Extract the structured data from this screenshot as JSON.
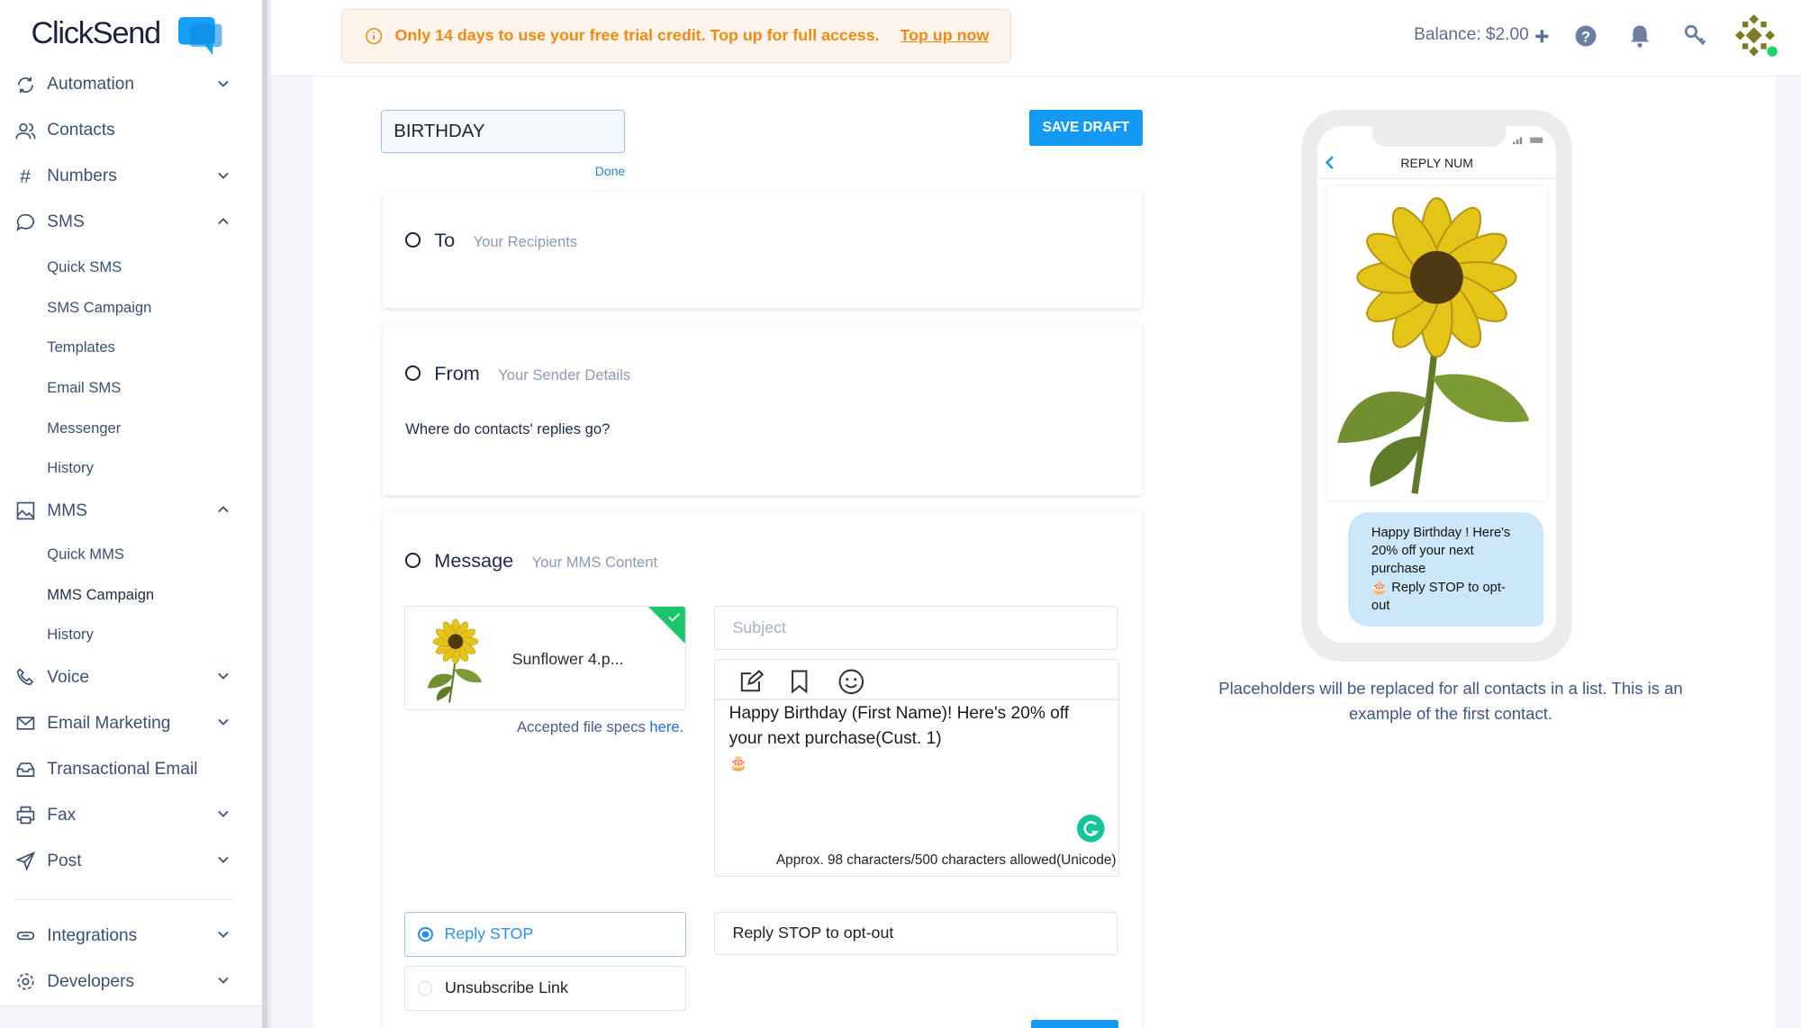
{
  "brand": {
    "logo_part1": "Click",
    "logo_part2": "Send",
    "accent": "#149af5"
  },
  "banner": {
    "text": "Only 14 days to use your free trial credit. Top up for full access.",
    "link": "Top up now"
  },
  "header": {
    "balance": "Balance: $2.00",
    "icons": [
      "plus-icon",
      "help-icon",
      "bell-icon",
      "key-icon",
      "avatar"
    ]
  },
  "sidebar": {
    "items": [
      {
        "label": "Automation"
      },
      {
        "label": "Contacts"
      },
      {
        "label": "Numbers"
      },
      {
        "label": "SMS"
      },
      {
        "label": "MMS"
      },
      {
        "label": "Voice"
      },
      {
        "label": "Email Marketing"
      },
      {
        "label": "Transactional Email"
      },
      {
        "label": "Fax"
      },
      {
        "label": "Post"
      },
      {
        "label": "Integrations"
      },
      {
        "label": "Developers"
      }
    ],
    "sms_sub": [
      "Quick SMS",
      "SMS Campaign",
      "Templates",
      "Email SMS",
      "Messenger",
      "History"
    ],
    "mms_sub": [
      "Quick MMS",
      "MMS Campaign",
      "History"
    ]
  },
  "editor": {
    "campaign_name": "BIRTHDAY",
    "done": "Done",
    "save_draft": "SAVE DRAFT",
    "to": {
      "title": "To",
      "sub": "Your Recipients"
    },
    "from": {
      "title": "From",
      "sub": "Your Sender Details",
      "question": "Where do contacts' replies go?"
    },
    "message": {
      "title": "Message",
      "sub": "Your MMS Content",
      "file_name": "Sunflower 4.p...",
      "specs_text": "Accepted file specs ",
      "specs_link": "here.",
      "subject_placeholder": "Subject",
      "body": "Happy Birthday (First Name)!  Here's 20% off your next purchase(Cust. 1)",
      "emoji": "🎂",
      "counter": "Approx. 98 characters/500 characters allowed(Unicode)",
      "optout_options": [
        "Reply STOP",
        "Unsubscribe Link"
      ],
      "optout_text": "Reply STOP to opt-out"
    }
  },
  "preview": {
    "header": "REPLY NUM",
    "bubble": "Happy Birthday ! Here's 20% off your next purchase",
    "bubble_line2": "🎂 Reply STOP to opt-out",
    "caption": "Placeholders will be replaced for all contacts in a list. This is an example of the first contact."
  }
}
